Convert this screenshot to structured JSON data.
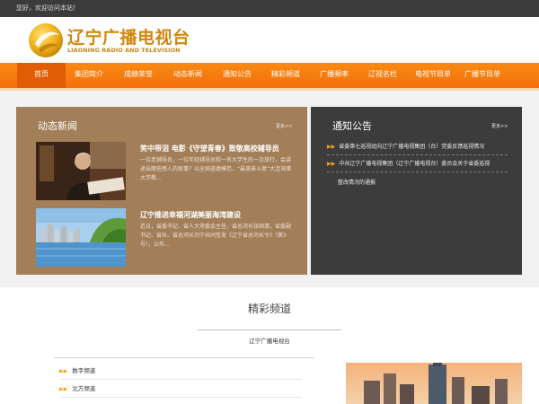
{
  "topbar": {
    "welcome": "您好，欢迎访问本站！"
  },
  "header": {
    "logo_cn": "辽宁广播电视台",
    "logo_en": "LIAONING RADIO AND TELEVISION"
  },
  "nav": {
    "items": [
      "首页",
      "集团简介",
      "成绩荣誉",
      "动态新闻",
      "通知公告",
      "精彩频道",
      "广播频率",
      "辽视名栏",
      "电视节目单",
      "广播节目单"
    ],
    "active": "首页"
  },
  "news": {
    "title": "动态新闻",
    "more": "更多>>",
    "items": [
      {
        "title": "笑中带泪 电影《守望青春》致敬高校辅导员",
        "summary": "一位老辅导员，一位年轻辅导员和一名大学生的一次旅行，会讲述出哪些感人的故事？以全国道德模范、“最美奋斗者”大连海事大学教..."
      },
      {
        "title": "辽宁推进幸福河湖美丽海湾建设",
        "summary": "近日，省委书记、省人大常委会主任、省总河长张国清，省委副书记、省长、省总河长刘宁共同签发《辽宁省总河长令》（第3号），公布..."
      }
    ]
  },
  "notice": {
    "title": "通知公告",
    "more": "更多>>",
    "items": [
      {
        "text": "省委第七巡视组向辽宁广播电视集团（台）党委反馈巡视情况"
      },
      {
        "text": "中共辽宁广播电视集团（辽宁广播电视台）委员会关于省委巡视",
        "cont": "整改情况的通报"
      }
    ]
  },
  "channels": {
    "title": "精彩频道",
    "tab": "辽宁广播电视台",
    "items": [
      "数字频道",
      "北方频道",
      ""
    ]
  },
  "colors": {
    "nav_orange": "#f3700a",
    "nav_active": "#e05d05",
    "news_panel": "#a37f59",
    "notice_panel": "#3c3c3c",
    "logo_gold": "#d2860c",
    "arrow": "#f7a31c"
  }
}
